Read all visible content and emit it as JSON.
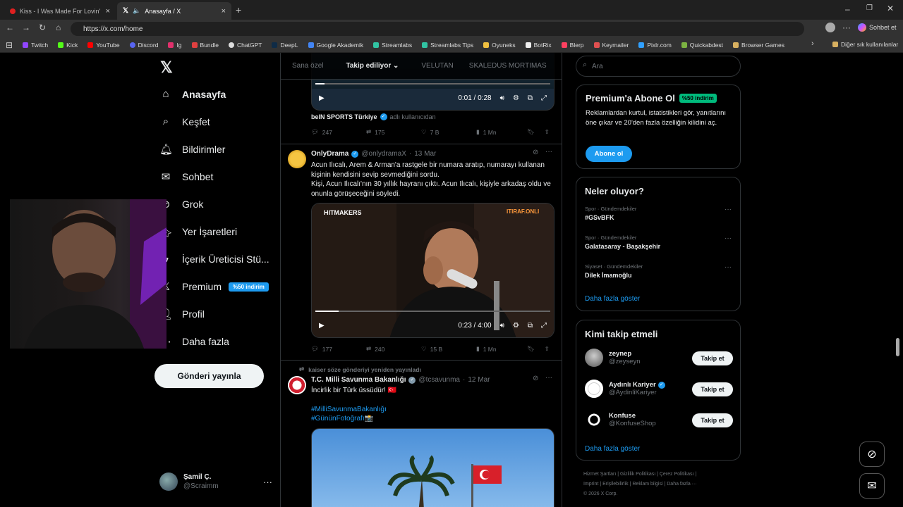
{
  "browser": {
    "tabs": [
      {
        "title": "Kiss - I Was Made For Lovin' You"
      },
      {
        "title": "Anasayfa / X"
      }
    ],
    "url": "https://x.com/home",
    "copilot_label": "Sohbet et",
    "bookmarks": [
      "Twitch",
      "Kick",
      "YouTube",
      "Discord",
      "Ig",
      "Bundle",
      "ChatGPT",
      "DeepL",
      "Google Akademik",
      "Streamlabs",
      "Streamlabs Tips",
      "Oyuneks",
      "BotRix",
      "Blerp",
      "Keymailer",
      "Pixlr.com",
      "Quickabdest",
      "Browser Games"
    ],
    "bookmarks_other": "Diğer sık kullanılanlar"
  },
  "sidebar": {
    "items": [
      {
        "label": "Anasayfa"
      },
      {
        "label": "Keşfet"
      },
      {
        "label": "Bildirimler"
      },
      {
        "label": "Sohbet"
      },
      {
        "label": "Grok"
      },
      {
        "label": "Yer İşaretleri"
      },
      {
        "label": "İçerik Üreticisi Stü..."
      },
      {
        "label": "Premium"
      },
      {
        "label": "Profil"
      },
      {
        "label": "Daha fazla"
      }
    ],
    "premium_badge": "%50 indirim",
    "post_button": "Gönderi yayınla",
    "account": {
      "name": "Şamil Ç.",
      "handle": "@Scraimm"
    }
  },
  "feed": {
    "tabs": [
      "Sana özel",
      "Takip ediliyor",
      "VELUTAN",
      "SKALEDUS MORTIMAS"
    ],
    "tweet0": {
      "video_time": "0:01 / 0:28",
      "video_progress": 0.04,
      "source_name": "beIN SPORTS Türkiye",
      "source_suffix": "adlı kullanıcıdan",
      "replies": "247",
      "retweets": "175",
      "likes": "7 B",
      "views": "1 Mn"
    },
    "tweet1": {
      "name": "OnlyDrama",
      "handle": "@onlydramaX",
      "date": "13 Mar",
      "text1": "Acun Ilıcalı, Arem & Arman'a rastgele bir numara aratıp, numarayı kullanan kişinin kendisini sevip sevmediğini sordu.",
      "text2": "Kişi, Acun Ilıcalı'nın 30 yıllık hayranı çıktı. Acun Ilıcalı, kişiyle arkadaş oldu ve onunla görüşeceğini söyledi.",
      "video_label_left": "HITMAKERS",
      "video_label_right": "ITIRAF.ONLI",
      "video_time": "0:23 / 4:00",
      "video_progress": 0.1,
      "replies": "177",
      "retweets": "240",
      "likes": "15 B",
      "views": "1 Mn"
    },
    "tweet2": {
      "repost_by": "kaiser söze gönderiyi yeniden yayınladı",
      "name": "T.C. Milli Savunma Bakanlığı",
      "handle": "@tcsavunma",
      "date": "12 Mar",
      "text": "İncirlik bir Türk üssüdür! 🇹🇷",
      "hashtag1": "#MilliSavunmaBakanlığı",
      "hashtag2": "#GününFotoğrafı📸"
    }
  },
  "right": {
    "search_placeholder": "Ara",
    "premium": {
      "title": "Premium'a Abone Ol",
      "badge": "%50 indirim",
      "text": "Reklamlardan kurtul, istatistikleri gör, yanıtlarını öne çıkar ve 20'den fazla özelliğin kilidini aç.",
      "button": "Abone ol"
    },
    "trends": {
      "title": "Neler oluyor?",
      "items": [
        {
          "category": "Spor · Gündemdekiler",
          "name": "#GSvBFK"
        },
        {
          "category": "Spor · Gündemdekiler",
          "name": "Galatasaray - Başakşehir"
        },
        {
          "category": "Siyaset · Gündemdekiler",
          "name": "Dilek İmamoğlu"
        }
      ],
      "more": "Daha fazla göster"
    },
    "who": {
      "title": "Kimi takip etmeli",
      "items": [
        {
          "name": "zeynep",
          "handle": "@zeyseyn"
        },
        {
          "name": "Aydınlı Kariyer",
          "handle": "@AydinliKariyer"
        },
        {
          "name": "Konfuse",
          "handle": "@KonfuseShop"
        }
      ],
      "follow": "Takip et",
      "more": "Daha fazla göster"
    },
    "footer": {
      "line1": "Hizmet Şartları | Gizlilik Politikası | Çerez Politikası |",
      "line2": "Imprint | Erişilebilirlik | Reklam bilgisi | Daha fazla ···",
      "line3": "© 2026 X Corp."
    }
  }
}
